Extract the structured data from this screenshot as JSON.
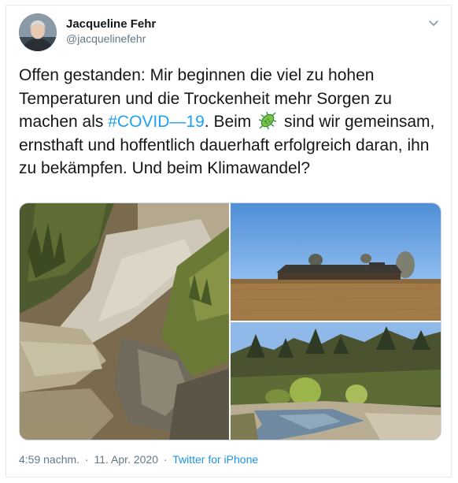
{
  "user": {
    "display_name": "Jacqueline Fehr",
    "handle": "@jacquelinefehr"
  },
  "tweet": {
    "text_1": "Offen gestanden: Mir beginnen die viel zu hohen Temperaturen und die Trockenheit mehr Sorgen zu machen als ",
    "hashtag": "#COVID—19",
    "text_2": ". Beim ",
    "emoji": "microbe-emoji",
    "text_3": " sind wir gemeinsam, ernsthaft und hoffentlich dauerhaft erfolgreich daran, ihn zu bekämpfen. Und beim Klimawandel?"
  },
  "media": {
    "photos": [
      "dry-riverbed-photo",
      "field-barn-photo",
      "river-forest-photo"
    ]
  },
  "meta": {
    "time": "4:59 nachm.",
    "separator": "·",
    "date": "11. Apr. 2020",
    "source": "Twitter for iPhone"
  },
  "colors": {
    "link": "#1da1f2",
    "text": "#14171a",
    "secondary": "#657786",
    "border": "#e1e8ed"
  },
  "icons": {
    "caret": "chevron-down-icon"
  }
}
